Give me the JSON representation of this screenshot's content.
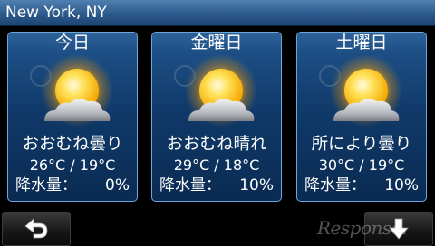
{
  "header": {
    "location": "New York, NY",
    "bar_color": "#2c5a8c"
  },
  "forecast": [
    {
      "day": "今日",
      "condition": "おおむね曇り",
      "temps": "26°C / 19°C",
      "precip_label": "降水量：",
      "precip_value": "0%",
      "icon": "sun-behind-cloud-icon"
    },
    {
      "day": "金曜日",
      "condition": "おおむね晴れ",
      "temps": "29°C / 18°C",
      "precip_label": "降水量：",
      "precip_value": "10%",
      "icon": "sun-behind-cloud-icon"
    },
    {
      "day": "土曜日",
      "condition": "所により曇り",
      "temps": "30°C / 19°C",
      "precip_label": "降水量：",
      "precip_value": "10%",
      "icon": "sun-behind-cloud-icon"
    }
  ],
  "footer": {
    "back_icon": "back-arrow-icon",
    "scroll_icon": "down-arrow-icon",
    "watermark": "Response."
  },
  "colors": {
    "card_border": "#6fa6da",
    "card_top": "#2d6299",
    "card_bottom": "#0a2b52",
    "sun_core": "#ffd21a",
    "sun_glow": "#ffb300"
  }
}
